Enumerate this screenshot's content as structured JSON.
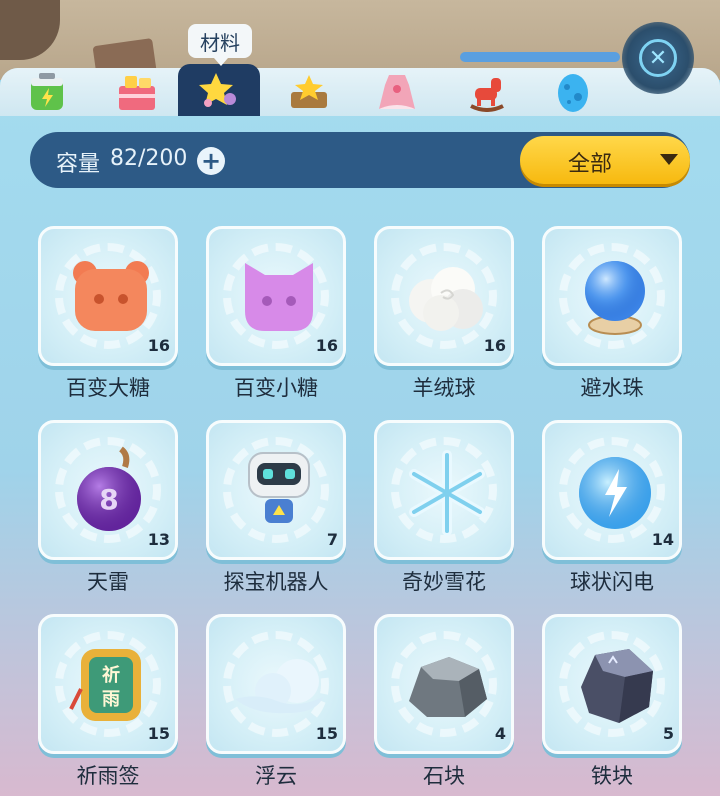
{
  "tabs": {
    "active_label": "材料",
    "items": [
      {
        "icon": "battery-icon"
      },
      {
        "icon": "gift-box-icon"
      },
      {
        "icon": "star-materials-icon"
      },
      {
        "icon": "star-crown-icon"
      },
      {
        "icon": "dress-icon"
      },
      {
        "icon": "rocking-horse-icon"
      },
      {
        "icon": "blue-egg-icon"
      }
    ]
  },
  "capacity": {
    "label": "容量",
    "value": "82/200"
  },
  "filter": {
    "label": "全部"
  },
  "items": [
    {
      "name": "百变大糖",
      "count": "16",
      "icon": "orange-bear-candy-icon"
    },
    {
      "name": "百变小糖",
      "count": "16",
      "icon": "purple-cat-candy-icon"
    },
    {
      "name": "羊绒球",
      "count": "16",
      "icon": "wool-ball-icon"
    },
    {
      "name": "避水珠",
      "count": "",
      "icon": "water-orb-icon"
    },
    {
      "name": "天雷",
      "count": "13",
      "icon": "bomb-icon"
    },
    {
      "name": "探宝机器人",
      "count": "7",
      "icon": "robot-icon"
    },
    {
      "name": "奇妙雪花",
      "count": "",
      "icon": "snowflake-icon"
    },
    {
      "name": "球状闪电",
      "count": "14",
      "icon": "lightning-orb-icon"
    },
    {
      "name": "祈雨签",
      "count": "15",
      "icon": "rain-charm-icon"
    },
    {
      "name": "浮云",
      "count": "15",
      "icon": "cloud-icon"
    },
    {
      "name": "石块",
      "count": "4",
      "icon": "stone-icon"
    },
    {
      "name": "铁块",
      "count": "5",
      "icon": "iron-ore-icon"
    }
  ],
  "colors": {
    "panel": "#9fd3ea",
    "capbar": "#2d5a86",
    "filter": "#f7b90f",
    "active_tab": "#1f3c63"
  }
}
